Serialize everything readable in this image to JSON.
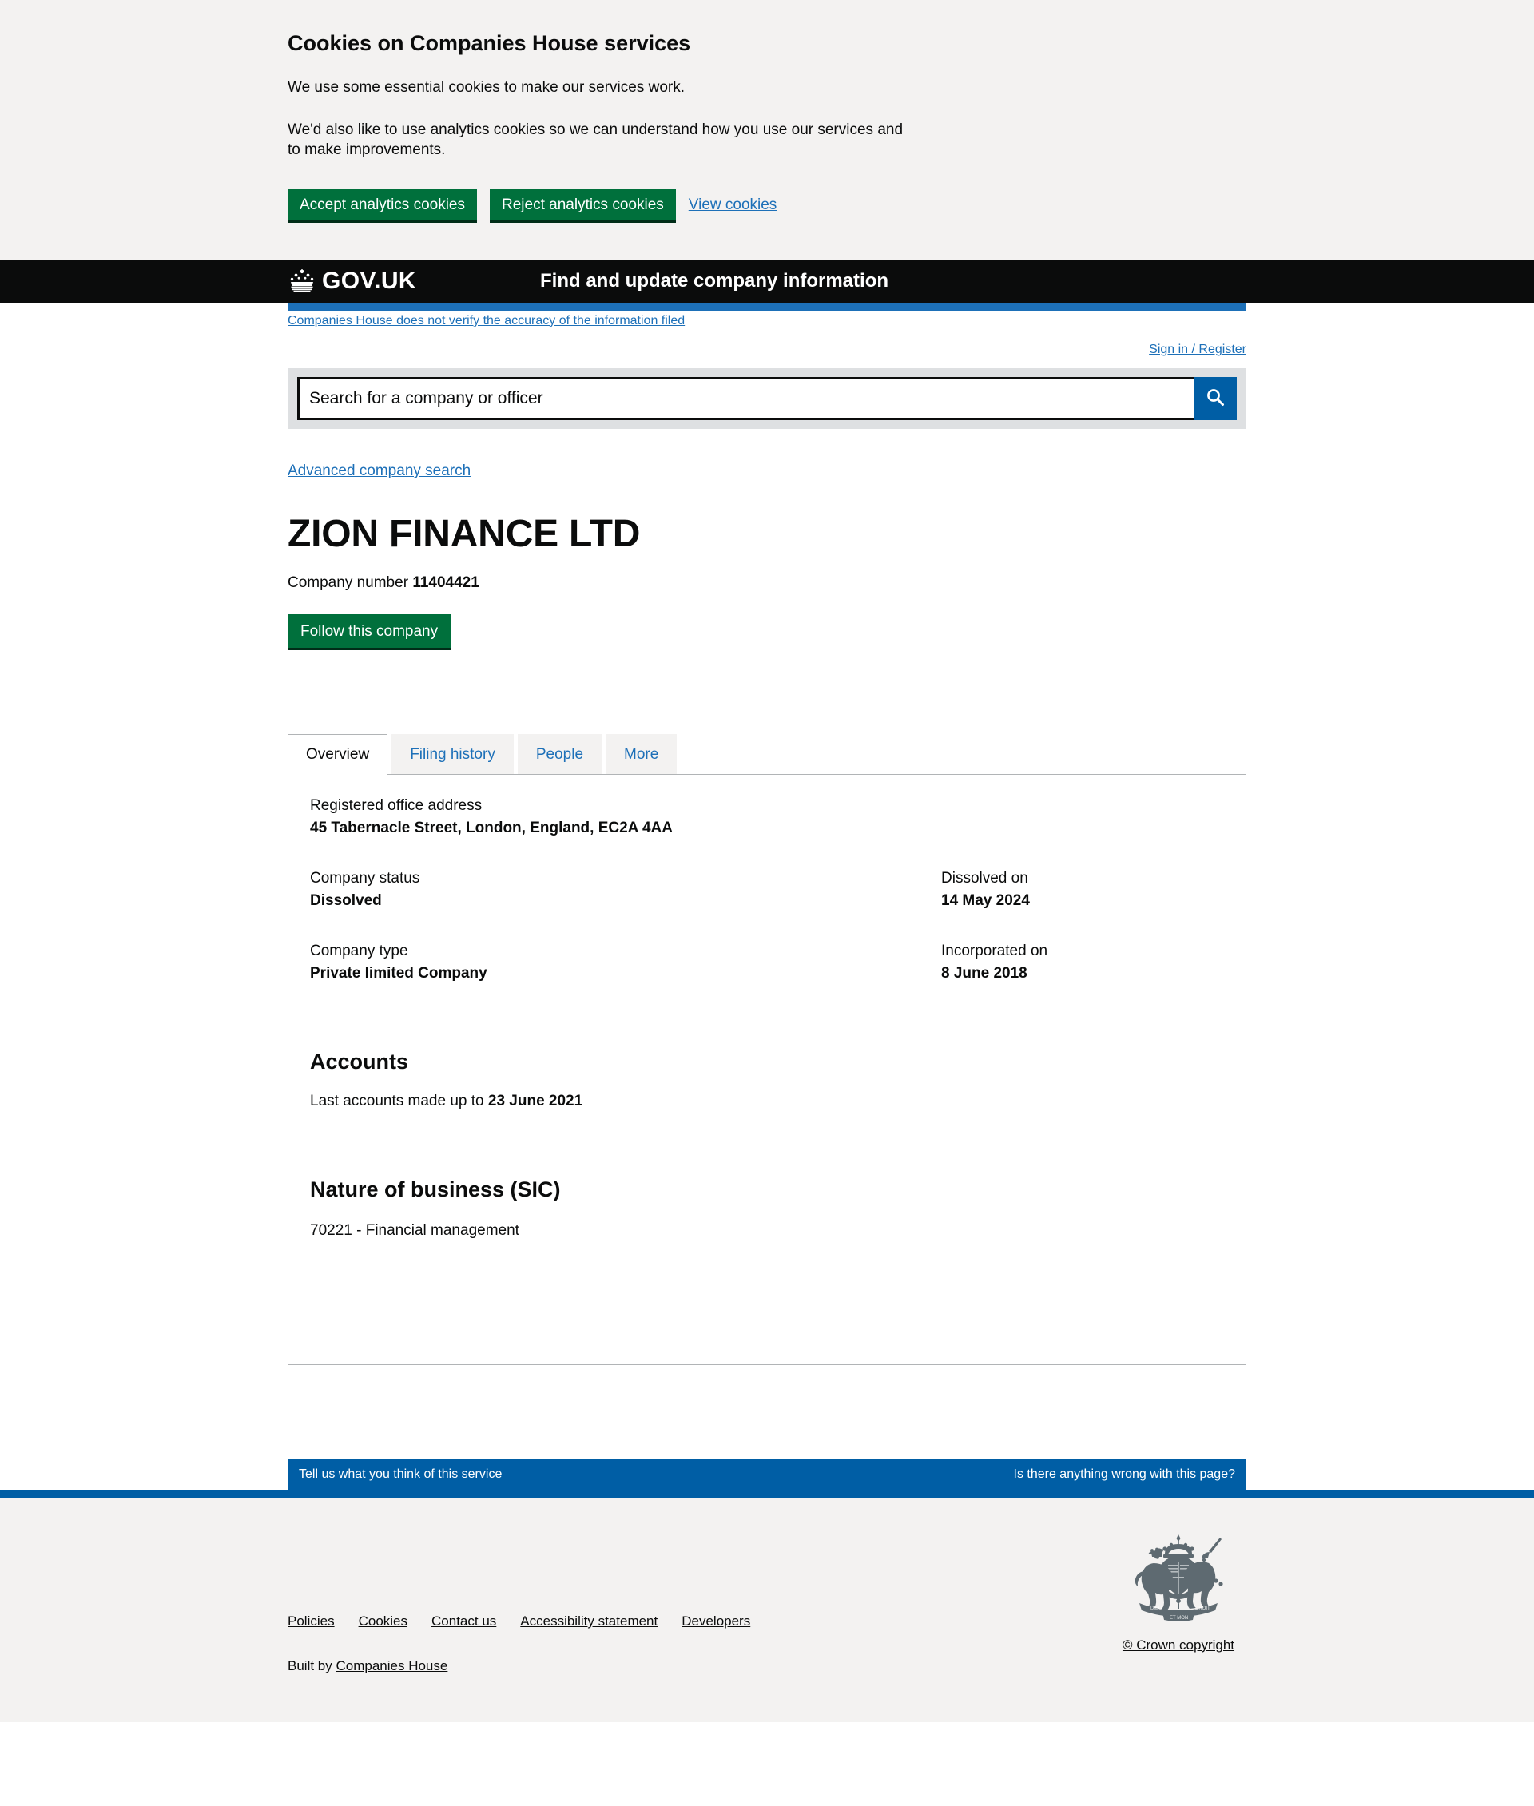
{
  "cookie_banner": {
    "title": "Cookies on Companies House services",
    "paragraph_1": "We use some essential cookies to make our services work.",
    "paragraph_2": "We'd also like to use analytics cookies so we can understand how you use our services and to make improvements.",
    "accept_label": "Accept analytics cookies",
    "reject_label": "Reject analytics cookies",
    "view_cookies_label": "View cookies"
  },
  "header": {
    "wordmark": "GOV.UK",
    "service_name": "Find and update company information",
    "crown_icon": "crown-icon"
  },
  "sub_header": {
    "disclaimer_link": "Companies House does not verify the accuracy of the information filed",
    "sign_in_label": "Sign in / Register"
  },
  "search": {
    "placeholder": "Search for a company or officer",
    "value": "",
    "button_icon": "search-icon",
    "advanced_search_label": "Advanced company search"
  },
  "company": {
    "name": "ZION FINANCE LTD",
    "company_number_label": "Company number",
    "company_number": "11404421",
    "follow_button_label": "Follow this company"
  },
  "tabs": [
    {
      "label": "Overview",
      "active": true
    },
    {
      "label": "Filing history",
      "active": false
    },
    {
      "label": "People",
      "active": false
    },
    {
      "label": "More",
      "active": false
    }
  ],
  "overview": {
    "registered_office_label": "Registered office address",
    "registered_office_value": "45 Tabernacle Street, London, England, EC2A 4AA",
    "company_status_label": "Company status",
    "company_status_value": "Dissolved",
    "dissolved_on_label": "Dissolved on",
    "dissolved_on_value": "14 May 2024",
    "company_type_label": "Company type",
    "company_type_value": "Private limited Company",
    "incorporated_on_label": "Incorporated on",
    "incorporated_on_value": "8 June 2018",
    "accounts_heading": "Accounts",
    "accounts_prefix": "Last accounts made up to ",
    "accounts_date": "23 June 2021",
    "sic_heading": "Nature of business (SIC)",
    "sic_value": "70221 - Financial management"
  },
  "feedback": {
    "left_link": "Tell us what you think of this service",
    "right_link": "Is there anything wrong with this page?"
  },
  "footer": {
    "links": [
      "Policies",
      "Cookies",
      "Contact us",
      "Accessibility statement",
      "Developers"
    ],
    "built_by_prefix": "Built by ",
    "built_by_link": "Companies House",
    "crown_copyright": "© Crown copyright",
    "crest_icon": "royal-coat-of-arms-icon"
  },
  "colors": {
    "govuk_black": "#0b0c0c",
    "govuk_blue": "#1d70b8",
    "ch_blue": "#005ea5",
    "green": "#00703c",
    "light_grey": "#f3f2f1",
    "mid_grey": "#dee0e2",
    "border_grey": "#b1b4b6"
  }
}
